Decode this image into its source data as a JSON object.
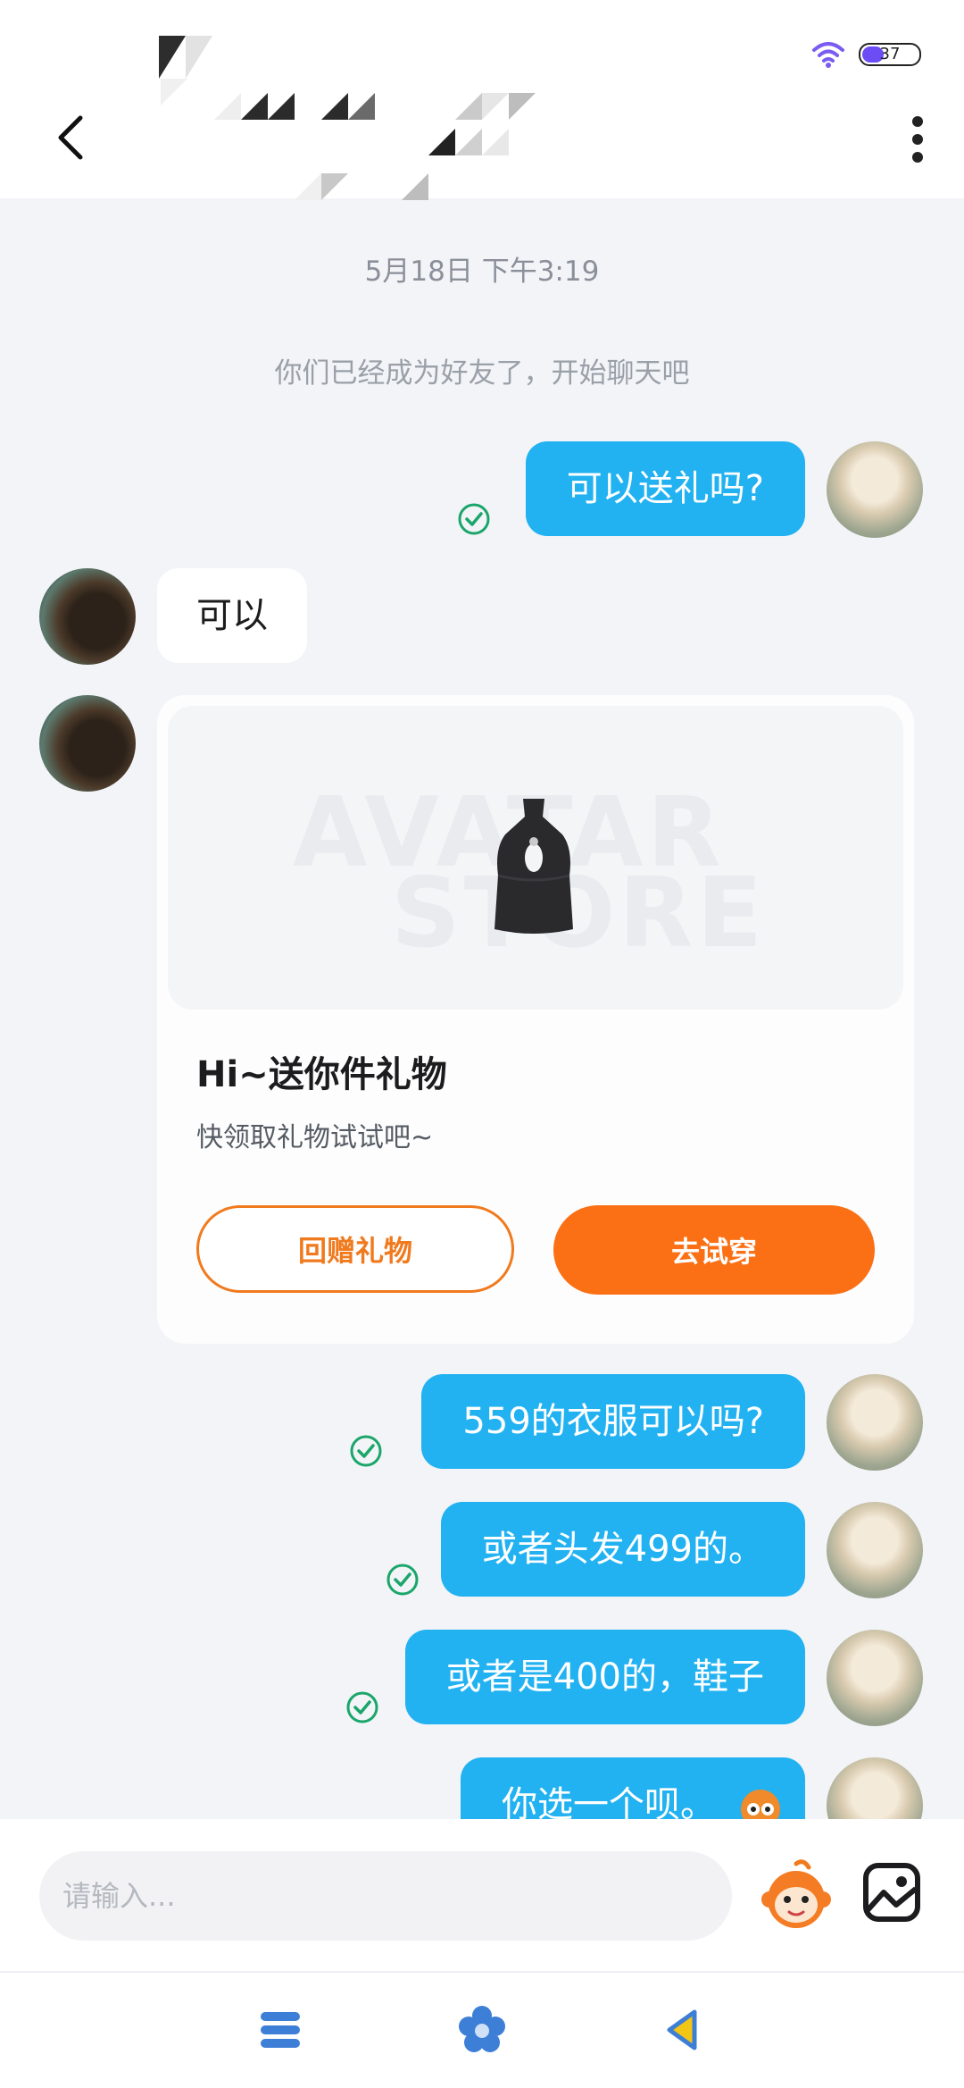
{
  "status_bar": {
    "battery": "37"
  },
  "chat": {
    "timestamp": "5月18日 下午3:19",
    "system_message": "你们已经成为好友了，开始聊天吧"
  },
  "messages": {
    "m1": "可以送礼吗?",
    "m2": "可以",
    "m3": "559的衣服可以吗?",
    "m4": "或者头发499的。",
    "m5": "或者是400的，鞋子",
    "m6": "你选一个呗。"
  },
  "gift_card": {
    "watermark_line1": "AVATAR",
    "watermark_line2": "STORE",
    "title": "Hi~送你件礼物",
    "subtitle": "快领取礼物试试吧~",
    "return_gift_label": "回赠礼物",
    "try_on_label": "去试穿"
  },
  "input": {
    "placeholder": "请输入..."
  },
  "colors": {
    "outgoing_bubble": "#22b2f1",
    "accent_orange": "#fb7014",
    "read_check": "#1aa66a"
  }
}
